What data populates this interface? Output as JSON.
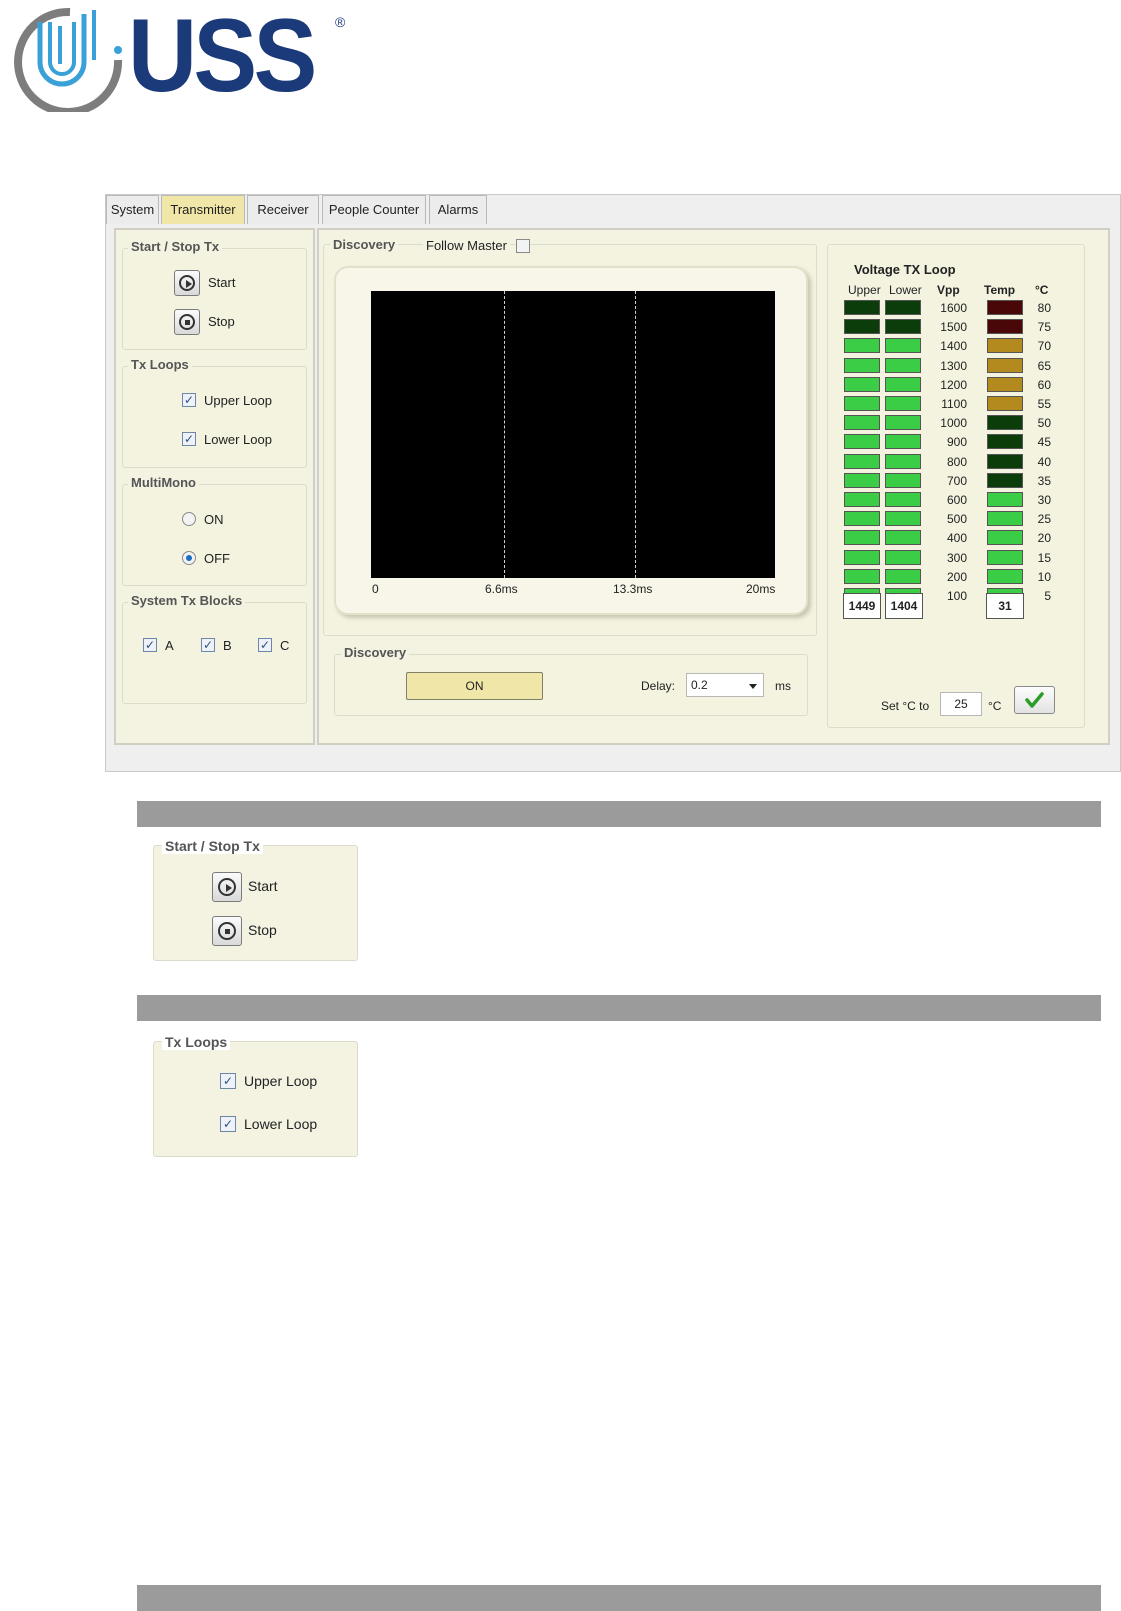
{
  "logo": {
    "text": "USS",
    "reg": "®"
  },
  "tabs": [
    "System",
    "Transmitter",
    "Receiver",
    "People Counter",
    "Alarms"
  ],
  "active_tab": "Transmitter",
  "start_stop": {
    "title": "Start / Stop Tx",
    "start": "Start",
    "stop": "Stop"
  },
  "tx_loops": {
    "title": "Tx Loops",
    "upper": "Upper Loop",
    "lower": "Lower Loop",
    "upper_checked": true,
    "lower_checked": true
  },
  "multimono": {
    "title": "MultiMono",
    "on": "ON",
    "off": "OFF",
    "selected": "OFF"
  },
  "tx_blocks": {
    "title": "System Tx Blocks",
    "items": [
      "A",
      "B",
      "C"
    ]
  },
  "discovery_panel": {
    "title": "Discovery",
    "follow_master": "Follow Master",
    "follow_checked": false
  },
  "scope": {
    "ticks": [
      "0",
      "6.6ms",
      "13.3ms",
      "20ms"
    ]
  },
  "discovery_ctrl": {
    "title": "Discovery",
    "button": "ON",
    "delay_label": "Delay:",
    "delay_value": "0.2",
    "unit": "ms"
  },
  "voltage": {
    "title": "Voltage TX Loop",
    "col_upper": "Upper",
    "col_lower": "Lower",
    "col_vpp": "Vpp",
    "col_temp": "Temp",
    "col_unit": "°C",
    "vpp_levels": [
      "1600",
      "1500",
      "1400",
      "1300",
      "1200",
      "1100",
      "1000",
      "900",
      "800",
      "700",
      "600",
      "500",
      "400",
      "300",
      "200",
      "100"
    ],
    "temp_levels": [
      "80",
      "75",
      "70",
      "65",
      "60",
      "55",
      "50",
      "45",
      "40",
      "35",
      "30",
      "25",
      "20",
      "15",
      "10",
      "5"
    ],
    "upper_value": "1449",
    "lower_value": "1404",
    "temp_value": "31",
    "set_label": "Set °C to",
    "set_value": "25",
    "set_unit": "°C"
  },
  "colors": {
    "bar_lit": "#3ccd46",
    "bar_dim": "#0b3d0b",
    "temp_hot": "#4a0707",
    "temp_warm": "#b38a1e",
    "temp_mid": "#0b3d0b",
    "tab_active": "#f0e6a8"
  }
}
